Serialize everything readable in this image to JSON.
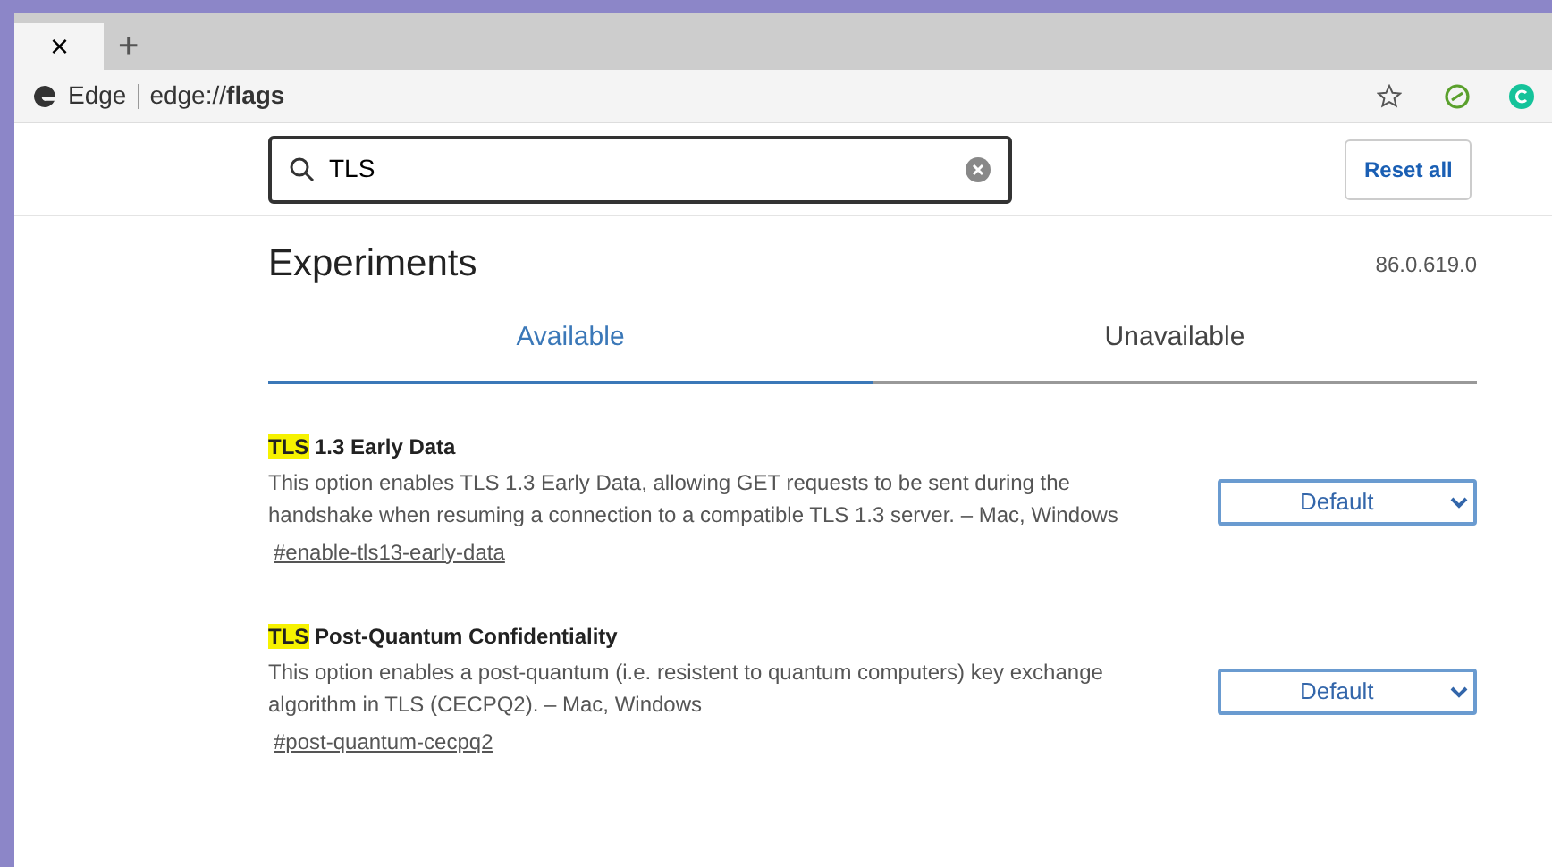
{
  "tabs": [
    {
      "close": "×"
    }
  ],
  "new_tab": "+",
  "address_bar": {
    "site": "Edge",
    "url": "edge://**flags**"
  },
  "search": {
    "value": "TLS"
  },
  "reset_button": "Reset all",
  "title": "Experiments",
  "version": "86.0.619.0",
  "page_tabs": [
    {
      "label": "Available",
      "selected": true
    },
    {
      "label": "Unavailable",
      "selected": false
    }
  ],
  "flags": [
    {
      "match": "TLS",
      "name": " 1.3 Early Data",
      "description": "This option enables TLS 1.3 Early Data, allowing GET requests to be sent during the handshake when resuming a connection to a compatible TLS 1.3 server. – Mac, Windows",
      "link": "#enable-tls13-early-data",
      "value": "Default"
    },
    {
      "match": "TLS",
      "name": " Post-Quantum Confidentiality",
      "description": "This option enables a post-quantum (i.e. resistent to quantum computers) key exchange algorithm in TLS (CECPQ2). – Mac, Windows",
      "link": "#post-quantum-cecpq2",
      "value": "Default"
    }
  ]
}
